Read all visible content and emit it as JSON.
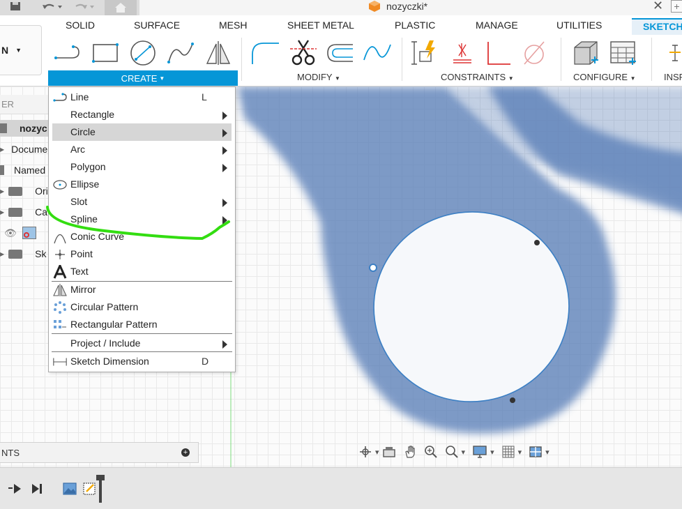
{
  "window": {
    "document_title": "nozyczki*"
  },
  "workspace": {
    "label": "N"
  },
  "tabs": [
    "SOLID",
    "SURFACE",
    "MESH",
    "SHEET METAL",
    "PLASTIC",
    "MANAGE",
    "UTILITIES",
    "SKETCH"
  ],
  "ribbon_groups": {
    "create": "CREATE",
    "modify": "MODIFY",
    "constraints": "CONSTRAINTS",
    "configure": "CONFIGURE",
    "inspect": "INSP"
  },
  "create_menu": {
    "items": [
      {
        "label": "Line",
        "shortcut": "L",
        "submenu": false,
        "icon": "line-icon"
      },
      {
        "label": "Rectangle",
        "shortcut": "",
        "submenu": true,
        "icon": ""
      },
      {
        "label": "Circle",
        "shortcut": "",
        "submenu": true,
        "icon": "",
        "highlighted": true
      },
      {
        "label": "Arc",
        "shortcut": "",
        "submenu": true,
        "icon": ""
      },
      {
        "label": "Polygon",
        "shortcut": "",
        "submenu": true,
        "icon": ""
      },
      {
        "label": "Ellipse",
        "shortcut": "",
        "submenu": false,
        "icon": "ellipse-icon"
      },
      {
        "label": "Slot",
        "shortcut": "",
        "submenu": true,
        "icon": ""
      },
      {
        "label": "Spline",
        "shortcut": "",
        "submenu": true,
        "icon": ""
      },
      {
        "label": "Conic Curve",
        "shortcut": "",
        "submenu": false,
        "icon": "conic-curve-icon"
      },
      {
        "label": "Point",
        "shortcut": "",
        "submenu": false,
        "icon": "point-icon"
      },
      {
        "label": "Text",
        "shortcut": "",
        "submenu": false,
        "icon": "text-icon"
      },
      {
        "label": "Mirror",
        "shortcut": "",
        "submenu": false,
        "icon": "mirror-icon"
      },
      {
        "label": "Circular Pattern",
        "shortcut": "",
        "submenu": false,
        "icon": "circular-pattern-icon"
      },
      {
        "label": "Rectangular Pattern",
        "shortcut": "",
        "submenu": false,
        "icon": "rectangular-pattern-icon"
      },
      {
        "label": "Project / Include",
        "shortcut": "",
        "submenu": true,
        "icon": ""
      },
      {
        "label": "Sketch Dimension",
        "shortcut": "D",
        "submenu": false,
        "icon": "sketch-dimension-icon"
      }
    ]
  },
  "browser": {
    "header": "ER",
    "rows": [
      "nozyc",
      "Docume",
      "Named",
      "Ori",
      "Ca",
      "",
      "Sk"
    ]
  },
  "comments": {
    "label": "NTS"
  },
  "colors": {
    "accent": "#0696d7",
    "sketch_line": "#3b7fc4",
    "annotation": "#33dd11",
    "scissors": "#5a7fb8"
  }
}
